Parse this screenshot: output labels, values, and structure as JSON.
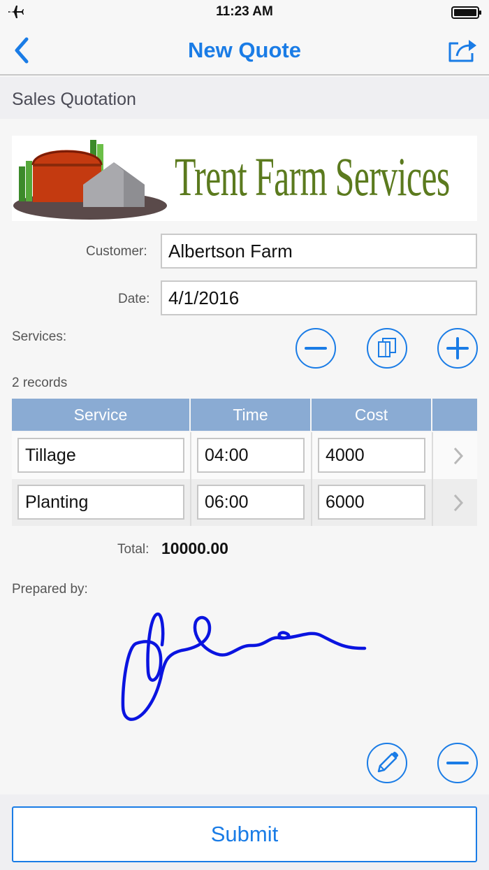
{
  "status_bar": {
    "time": "11:23 AM"
  },
  "navbar": {
    "title": "New Quote"
  },
  "section": {
    "title": "Sales Quotation"
  },
  "logo": {
    "text": "Trent Farm Services"
  },
  "form": {
    "customer_label": "Customer:",
    "customer_value": "Albertson Farm",
    "date_label": "Date:",
    "date_value": "4/1/2016",
    "services_label": "Services:"
  },
  "services": {
    "records_text": "2 records",
    "columns": [
      "Service",
      "Time",
      "Cost"
    ],
    "rows": [
      {
        "service": "Tillage",
        "time": "04:00",
        "cost": "4000"
      },
      {
        "service": "Planting",
        "time": "06:00",
        "cost": "6000"
      }
    ]
  },
  "totals": {
    "label": "Total:",
    "value": "10000.00"
  },
  "signature": {
    "label": "Prepared by:"
  },
  "submit_label": "Submit",
  "colors": {
    "accent": "#1a7ce6",
    "table_header": "#8aabd3",
    "logo_green": "#5b7a1e",
    "signature_ink": "#0a14e0"
  }
}
